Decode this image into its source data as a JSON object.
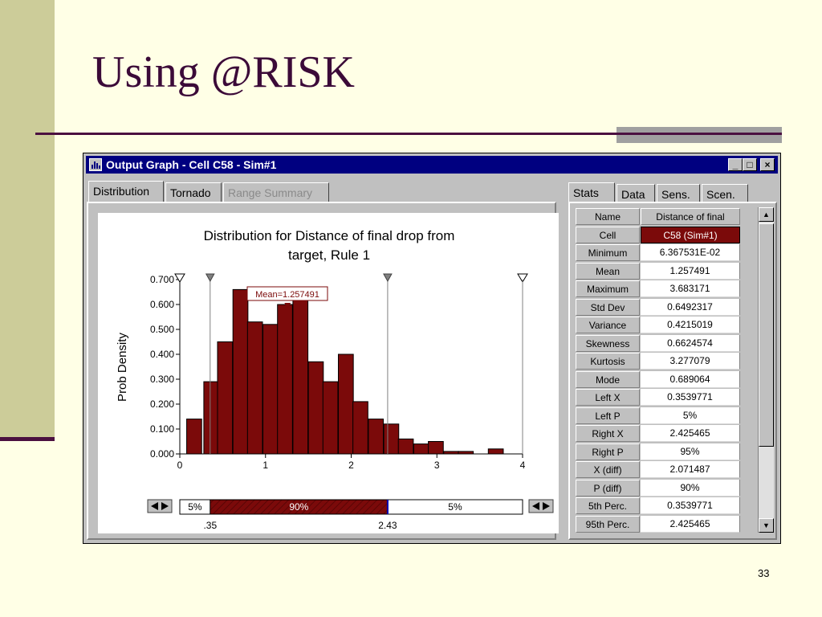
{
  "slide": {
    "title": "Using @RISK",
    "page_number": "33"
  },
  "window": {
    "title": "Output Graph - Cell C58 - Sim#1",
    "icon": "histogram-app-icon",
    "controls": {
      "minimize": "_",
      "maximize": "□",
      "close": "×"
    }
  },
  "left_tabs": [
    "Distribution",
    "Tornado",
    "Range Summary"
  ],
  "right_tabs": [
    "Stats",
    "Data",
    "Sens.",
    "Scen."
  ],
  "chart_data": {
    "type": "bar",
    "title_lines": [
      "Distribution for Distance of final drop from",
      "target, Rule 1"
    ],
    "ylabel": "Prob Density",
    "xlim": [
      0,
      4
    ],
    "ylim": [
      0,
      0.7
    ],
    "x_ticks": [
      "0",
      "1",
      "2",
      "3",
      "4"
    ],
    "y_ticks": [
      "0.000",
      "0.100",
      "0.200",
      "0.300",
      "0.400",
      "0.500",
      "0.600",
      "0.700"
    ],
    "bin_width": 0.2,
    "bin_starts": [
      0.08,
      0.28,
      0.44,
      0.62,
      0.79,
      0.97,
      1.14,
      1.32,
      1.5,
      1.67,
      1.85,
      2.02,
      2.2,
      2.38,
      2.55,
      2.73,
      2.9,
      3.08,
      3.25,
      3.6
    ],
    "bin_width_data": 0.175,
    "values": [
      0.14,
      0.29,
      0.45,
      0.66,
      0.53,
      0.52,
      0.6,
      0.66,
      0.37,
      0.29,
      0.4,
      0.21,
      0.14,
      0.12,
      0.06,
      0.04,
      0.05,
      0.01,
      0.01,
      0.02
    ],
    "bar_color": "#7b0a0a",
    "mean_label": "Mean=1.257491",
    "mean": 1.257491,
    "left_x": 0.3539771,
    "right_x": 2.425465,
    "left_marker_labels": [
      ".35",
      "2.43"
    ],
    "range_bar": {
      "left": "5%",
      "middle": "90%",
      "right": "5%"
    }
  },
  "stats": {
    "header": {
      "name": "Name",
      "value": "Distance of final"
    },
    "rows": [
      {
        "name": "Cell",
        "value": "C58 (Sim#1)"
      },
      {
        "name": "Minimum",
        "value": "6.367531E-02"
      },
      {
        "name": "Mean",
        "value": "1.257491"
      },
      {
        "name": "Maximum",
        "value": "3.683171"
      },
      {
        "name": "Std Dev",
        "value": "0.6492317"
      },
      {
        "name": "Variance",
        "value": "0.4215019"
      },
      {
        "name": "Skewness",
        "value": "0.6624574"
      },
      {
        "name": "Kurtosis",
        "value": "3.277079"
      },
      {
        "name": "Mode",
        "value": "0.689064"
      },
      {
        "name": "Left X",
        "value": "0.3539771"
      },
      {
        "name": "Left P",
        "value": "5%"
      },
      {
        "name": "Right X",
        "value": "2.425465"
      },
      {
        "name": "Right P",
        "value": "95%"
      },
      {
        "name": "X (diff)",
        "value": "2.071487"
      },
      {
        "name": "P (diff)",
        "value": "90%"
      },
      {
        "name": "5th Perc.",
        "value": "0.3539771"
      },
      {
        "name": "95th Perc.",
        "value": "2.425465"
      }
    ]
  }
}
